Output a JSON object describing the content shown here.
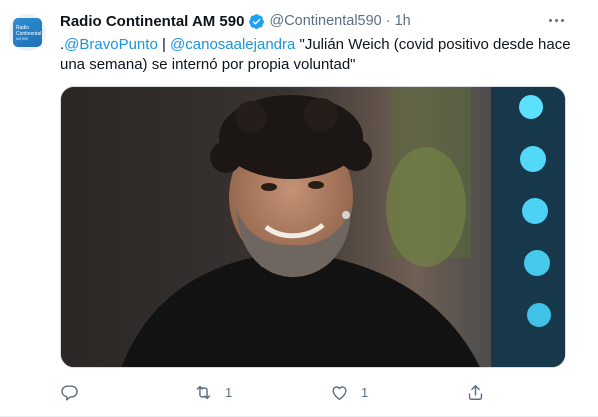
{
  "tweet": {
    "display_name": "Radio Continental AM 590",
    "handle": "@Continental590",
    "separator": "·",
    "time": "1h",
    "text_prefix": ".",
    "mention_1": "@BravoPunto",
    "divider": " | ",
    "mention_2": "@canosaalejandra",
    "body": " \"Julián Weich (covid positivo desde hace una semana) se internó por propia voluntad\""
  },
  "avatar": {
    "line_1": "Radio",
    "line_2": "Continental",
    "line_3": "AM 590"
  },
  "actions": {
    "reply_count": "",
    "retweet_count": "1",
    "like_count": "1"
  },
  "colors": {
    "link": "#1b95e0",
    "secondary_text": "#5b7083",
    "verified": "#1da1f2",
    "avatar": "#2f8fd4"
  },
  "icons": {
    "verified": "verified-badge-icon",
    "more": "more-options-icon",
    "reply": "reply-icon",
    "retweet": "retweet-icon",
    "like": "heart-icon",
    "share": "share-icon"
  }
}
